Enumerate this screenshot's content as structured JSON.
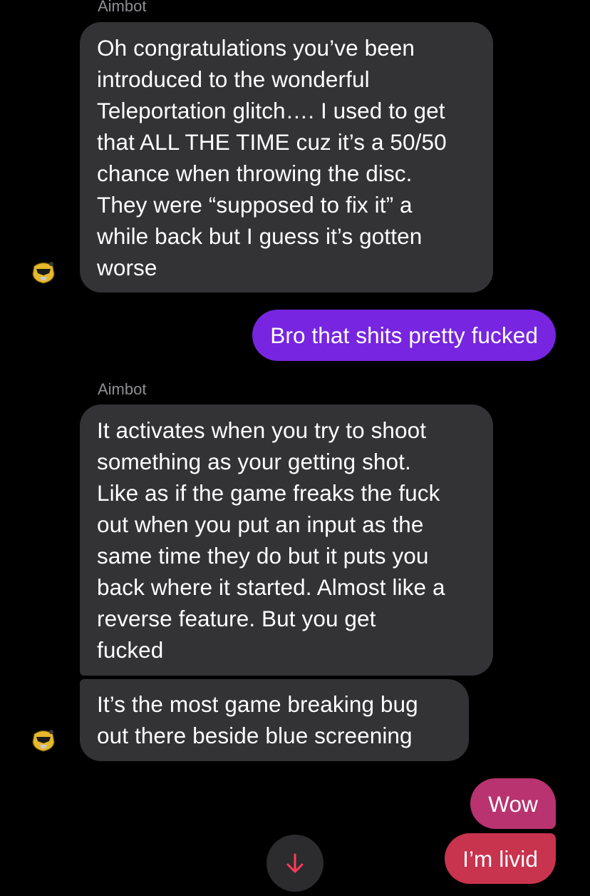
{
  "conversation": {
    "incoming_sender": "Aimbot",
    "messages": [
      {
        "direction": "incoming",
        "sender": "Aimbot",
        "lines": [
          "Oh congratulations you’ve been",
          "introduced to the wonderful",
          "Teleportation glitch…. I used to get",
          "that ALL THE TIME cuz it’s a 50/50",
          "chance when throwing the disc.",
          "They were “supposed to fix it” a",
          "while back but I guess it’s gotten",
          "worse"
        ]
      },
      {
        "direction": "outgoing",
        "text": "Bro that shits pretty fucked"
      },
      {
        "direction": "incoming",
        "sender": "Aimbot",
        "lines": [
          "It activates when you try to shoot",
          "something as your getting shot.",
          "Like as if the game freaks the fuck",
          "out when you put an input as the",
          "same time they do but it puts you",
          "back where it started. Almost like a",
          "reverse feature. But you get",
          "fucked"
        ]
      },
      {
        "direction": "incoming",
        "lines": [
          "It’s the most game breaking bug",
          "out there beside blue screening"
        ]
      },
      {
        "direction": "outgoing",
        "text": "Wow"
      },
      {
        "direction": "outgoing",
        "text": "I’m livid"
      }
    ]
  },
  "icons": {
    "avatar": "yellow-ranger-helmet-icon",
    "scroll_button": "arrow-down-icon"
  },
  "colors": {
    "background": "#000000",
    "incoming_bubble": "#333335",
    "outgoing_purple": "#7725e0",
    "outgoing_magenta_top": "#b8336f",
    "outgoing_magenta_bottom": "#c8334e",
    "sender_name": "#8e8e93",
    "scroll_arrow": "#ff3b57"
  }
}
